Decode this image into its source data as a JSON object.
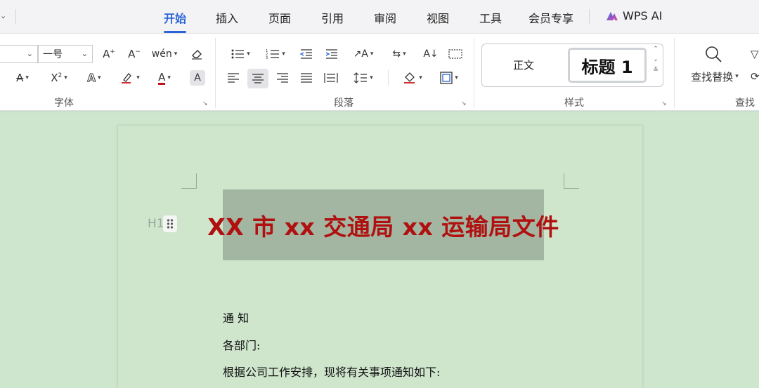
{
  "tabs": {
    "items": [
      {
        "label": "开始"
      },
      {
        "label": "插入"
      },
      {
        "label": "页面"
      },
      {
        "label": "引用"
      },
      {
        "label": "审阅"
      },
      {
        "label": "视图"
      },
      {
        "label": "工具"
      },
      {
        "label": "会员专享"
      }
    ],
    "wps_ai": "WPS AI"
  },
  "ribbon": {
    "font_group": {
      "label": "字体",
      "font_size_value": "一号"
    },
    "paragraph_group": {
      "label": "段落"
    },
    "styles_group": {
      "label": "样式",
      "normal_style": "正文",
      "heading_style": "标题 1"
    },
    "find_group": {
      "label": "查找",
      "find_replace": "查找替换"
    }
  },
  "document": {
    "h1_marker": "H1",
    "heading": "XX 市 xx 交通局 xx 运输局文件",
    "lines": [
      "通 知",
      "各部门:",
      "根据公司工作安排，现将有关事项通知如下:"
    ]
  },
  "colors": {
    "accent": "#2b64d9",
    "heading_text": "#b01010",
    "canvas": "#cde6cd",
    "highlight": "#a3b6a1"
  }
}
